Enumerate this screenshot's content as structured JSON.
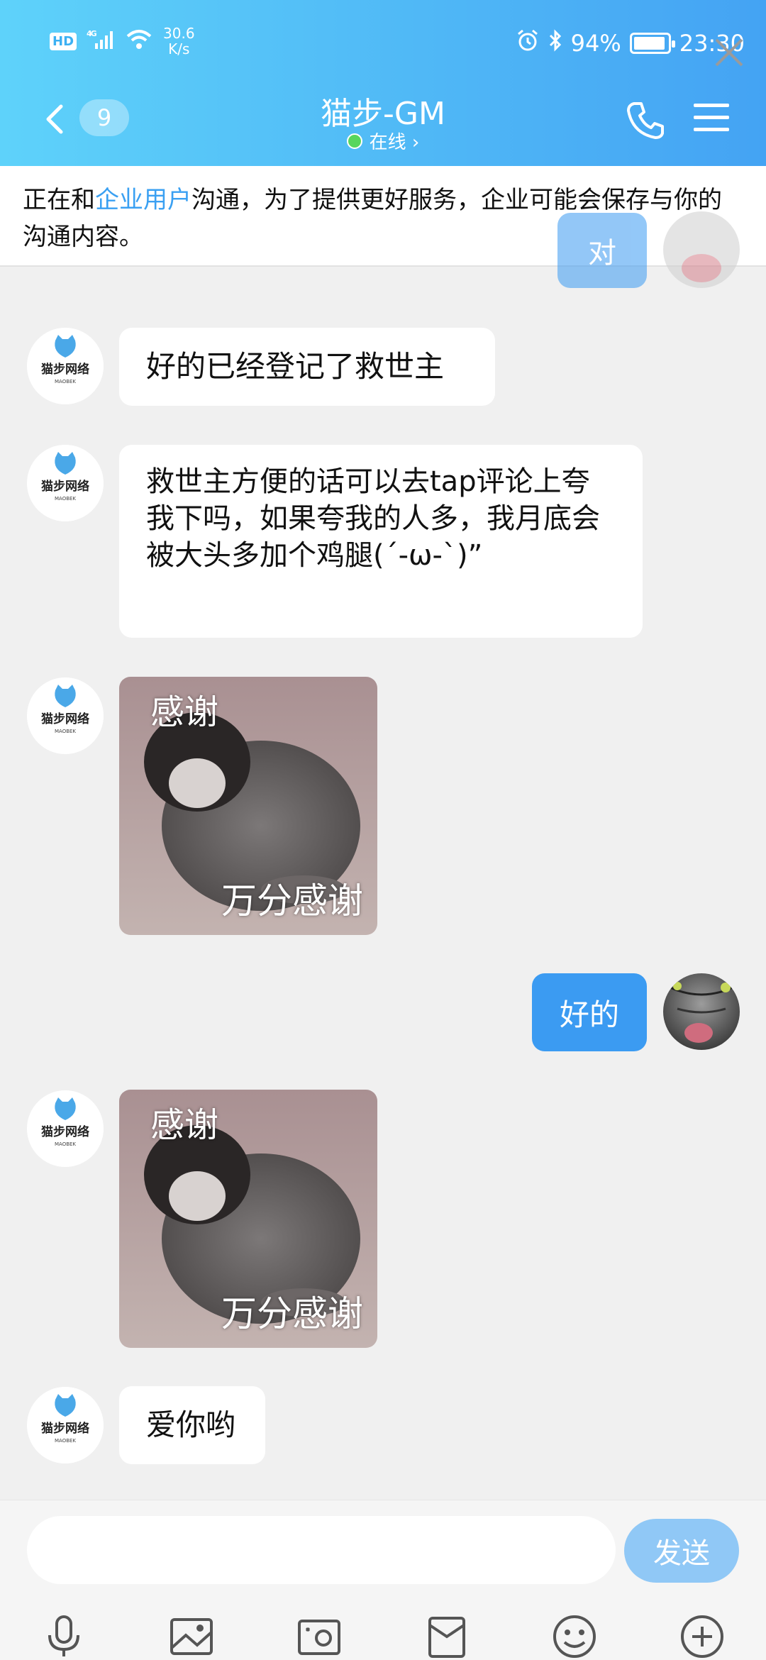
{
  "status_bar": {
    "hd": "HD",
    "network_type": "4G",
    "speed_value": "30.6",
    "speed_unit": "K/s",
    "battery_percent": "94%",
    "battery_level": 0.94,
    "time": "23:30"
  },
  "header": {
    "unread_badge": "9",
    "title": "猫步-GM",
    "status": "在线 ›"
  },
  "notice": {
    "prefix": "正在和",
    "highlight": "企业用户",
    "suffix": "沟通，为了提供更好服务，企业可能会保存与你的沟通内容。"
  },
  "messages": [
    {
      "side": "right",
      "type": "text",
      "text": "对"
    },
    {
      "side": "left",
      "type": "text",
      "text": "好的已经登记了救世主",
      "avatar_text": "猫步网络"
    },
    {
      "side": "left",
      "type": "text",
      "text": " 救世主方便的话可以去tap评论上夸我下吗，如果夸我的人多，我月底会被大头多加个鸡腿(´-ω-`)”",
      "avatar_text": "猫步网络"
    },
    {
      "side": "left",
      "type": "sticker",
      "caption_top": "感谢",
      "caption_bottom": "万分感谢",
      "avatar_text": "猫步网络"
    },
    {
      "side": "right",
      "type": "text",
      "text": "好的"
    },
    {
      "side": "left",
      "type": "sticker",
      "caption_top": "感谢",
      "caption_bottom": "万分感谢",
      "avatar_text": "猫步网络"
    },
    {
      "side": "left",
      "type": "text",
      "text": "爱你哟",
      "avatar_text": "猫步网络"
    }
  ],
  "avatar_sub": "MAOBEK",
  "input": {
    "placeholder": "",
    "send_label": "发送"
  },
  "toolbar": [
    "microphone-icon",
    "image-icon",
    "camera-icon",
    "folder-icon",
    "emoji-icon",
    "plus-icon"
  ],
  "colors": {
    "header_start": "#5ed2fa",
    "header_end": "#44a3f3",
    "bubble_self": "#3b9bf2",
    "highlight": "#3aa0f2",
    "send_button": "#90c8f6"
  }
}
